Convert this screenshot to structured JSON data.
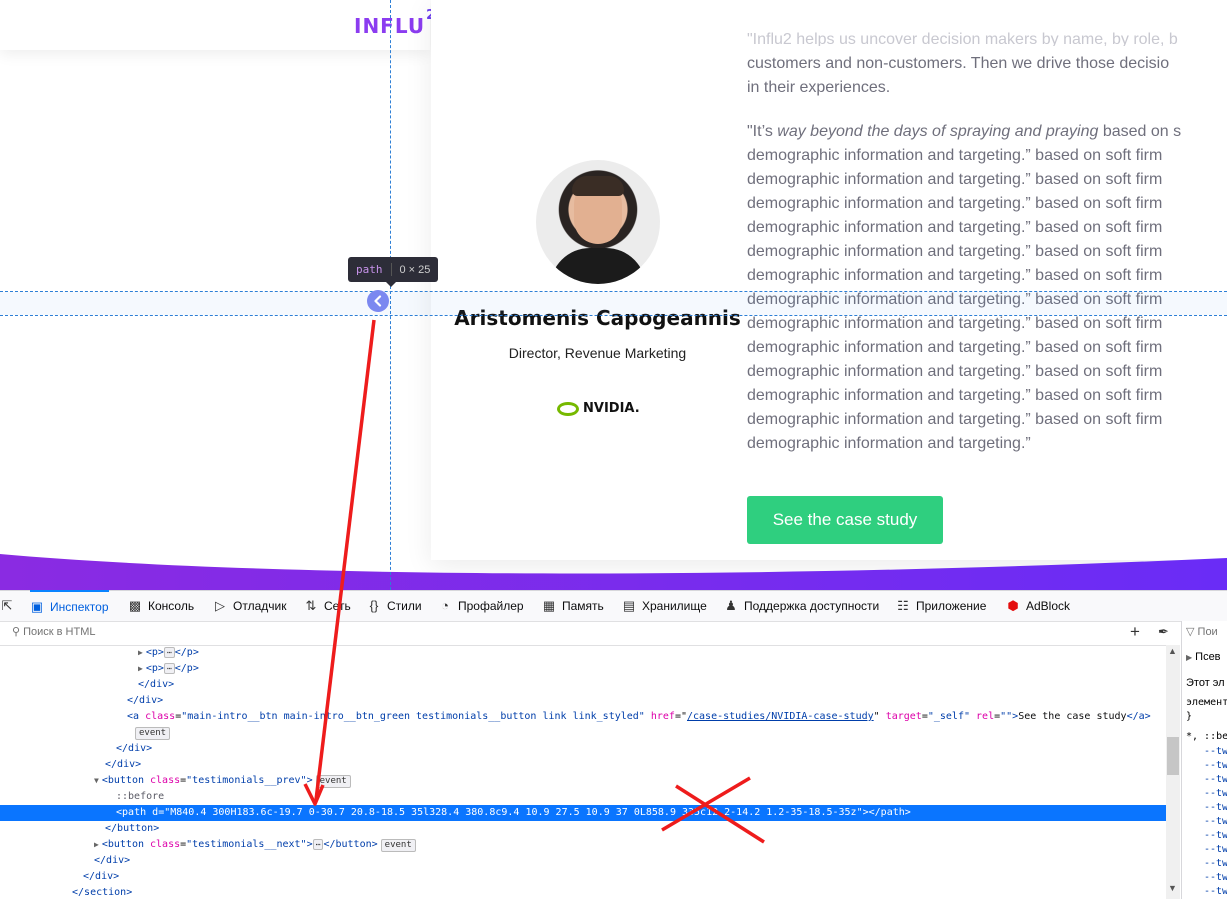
{
  "page": {
    "logo": {
      "text": "INFLU",
      "superscript": "2"
    },
    "quote_fade_line": "\"Influ2 helps us uncover decision makers by name, by role, b",
    "quote_lines_a": [
      "customers and non-customers. Then we drive those decisio",
      "in their experiences."
    ],
    "quote_b_first": {
      "pre": "\"It’s ",
      "em": "way beyond the days of spraying and praying",
      "post": " based on s"
    },
    "quote_b_repeat": "demographic information and targeting.” based on soft firm",
    "quote_b_last": "demographic information and targeting.”",
    "person": {
      "name": "Aristomenis Capogeannis",
      "role": "Director, Revenue Marketing"
    },
    "company_logo": {
      "text": "NVIDIA."
    },
    "cta_label": "See the case study",
    "colors": {
      "accent": "#8b3cf0",
      "cta": "#2fcf7f",
      "wave": "#7a2cf5",
      "prev_button": "#7b88f0"
    }
  },
  "overlay": {
    "tooltip": {
      "tag": "path",
      "dims": "0 × 25"
    }
  },
  "devtools": {
    "tabs": [
      {
        "label": "Инспектор",
        "icon": "inspector-icon",
        "active": true
      },
      {
        "label": "Консоль",
        "icon": "console-icon"
      },
      {
        "label": "Отладчик",
        "icon": "debugger-icon"
      },
      {
        "label": "Сеть",
        "icon": "network-icon"
      },
      {
        "label": "Стили",
        "icon": "style-editor-icon"
      },
      {
        "label": "Профайлер",
        "icon": "profiler-icon"
      },
      {
        "label": "Память",
        "icon": "memory-icon"
      },
      {
        "label": "Хранилище",
        "icon": "storage-icon"
      },
      {
        "label": "Поддержка доступности",
        "icon": "accessibility-icon"
      },
      {
        "label": "Приложение",
        "icon": "application-icon"
      },
      {
        "label": "AdBlock",
        "icon": "adblock-icon"
      }
    ],
    "search_placeholder": "Поиск в HTML",
    "tree": {
      "p": "p",
      "div_close": "/div",
      "a_tag": "a",
      "a_class_attr": "class",
      "a_class_val": "\"main-intro__btn main-intro__btn_green testimonials__button link link_styled\"",
      "a_href_attr": "href",
      "a_href_val": "/case-studies/NVIDIA-case-study",
      "a_target_attr": "target",
      "a_target_val": "\"_self\"",
      "a_rel_attr": "rel",
      "a_rel_val": "\"\"",
      "a_text": "See the case study",
      "a_close": "/a",
      "event": "event",
      "button_tag": "button",
      "button_class_attr": "class",
      "prev_class_val": "\"testimonials__prev\"",
      "before": "::before",
      "path_tag": "path",
      "path_d_attr": "d",
      "path_d_val": "\"M840.4 300H183.6c-19.7 0-30.7 20.8-18.5 35l328.4 380.8c9.4 10.9 27.5 10.9 37 0L858.9 335c12.2-14.2 1.2-35-18.5-35z\"",
      "path_close": "/path",
      "button_close": "/button",
      "next_class_val": "\"testimonials__next\"",
      "section_close": "/section"
    },
    "sidebar": {
      "filter_placeholder": "Пои",
      "pseudo_label": "Псев",
      "this_element": "Этот эл",
      "element_line": "элемент",
      "brace_close": "}",
      "rule_selector": "*, ::be",
      "var_prefix": "--tw"
    }
  }
}
